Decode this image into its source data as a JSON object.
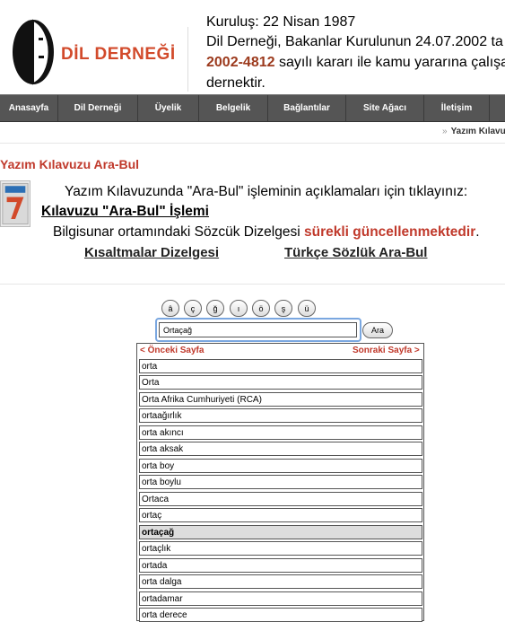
{
  "header": {
    "logo_name": "DİL DERNEĞİ",
    "info_lines": [
      "Kuruluş: 22 Nisan 1987",
      "Dil Derneği, Bakanlar Kurulunun 24.07.2002 ta",
      "sayılı kararı ile kamu yararına çalışa",
      "dernektir."
    ],
    "decree_number": "2002-4812"
  },
  "nav": [
    "Anasayfa",
    "Dil Derneği",
    "Üyelik",
    "Belgelik",
    "Bağlantılar",
    "Site Ağacı",
    "İletişim"
  ],
  "breadcrumb": {
    "arrow": "»",
    "current": "Yazım Kılavu"
  },
  "content": {
    "title": "Yazım Kılavuzu Ara-Bul",
    "line1": "Yazım Kılavuzunda \"Ara-Bul\" işleminin açıklamaları için tıklayınız:",
    "link1": "Kılavuzu \"Ara-Bul\" İşlemi",
    "line3_pre": "Bilgisunar ortamındaki Sözcük Dizelgesi ",
    "line3_em": "sürekli güncellenmektedir",
    "line3_post": ".",
    "link_abbrev": "Kısaltmalar Dizelgesi",
    "link_dict": "Türkçe Sözlük Ara-Bul"
  },
  "letters": [
    "â",
    "ç",
    "ğ",
    "ı",
    "ö",
    "ş",
    "ü"
  ],
  "search": {
    "value": "Ortaçağ",
    "button": "Ara"
  },
  "pager": {
    "prev": "< Önceki Sayfa",
    "next": "Sonraki Sayfa >"
  },
  "results": [
    "orta",
    "Orta",
    "Orta Afrika Cumhuriyeti (RCA)",
    "ortaağırlık",
    "orta akıncı",
    "orta aksak",
    "orta boy",
    "orta boylu",
    "Ortaca",
    "ortaç",
    "ortaçağ",
    "ortaçlık",
    "ortada",
    "orta dalga",
    "ortadamar",
    "orta derece"
  ],
  "selected_result": "ortaçağ",
  "colors": {
    "brand": "#d24a2b",
    "nav_bg": "#555555",
    "accent_red": "#c0392b",
    "search_focus": "#7aa7e0"
  }
}
